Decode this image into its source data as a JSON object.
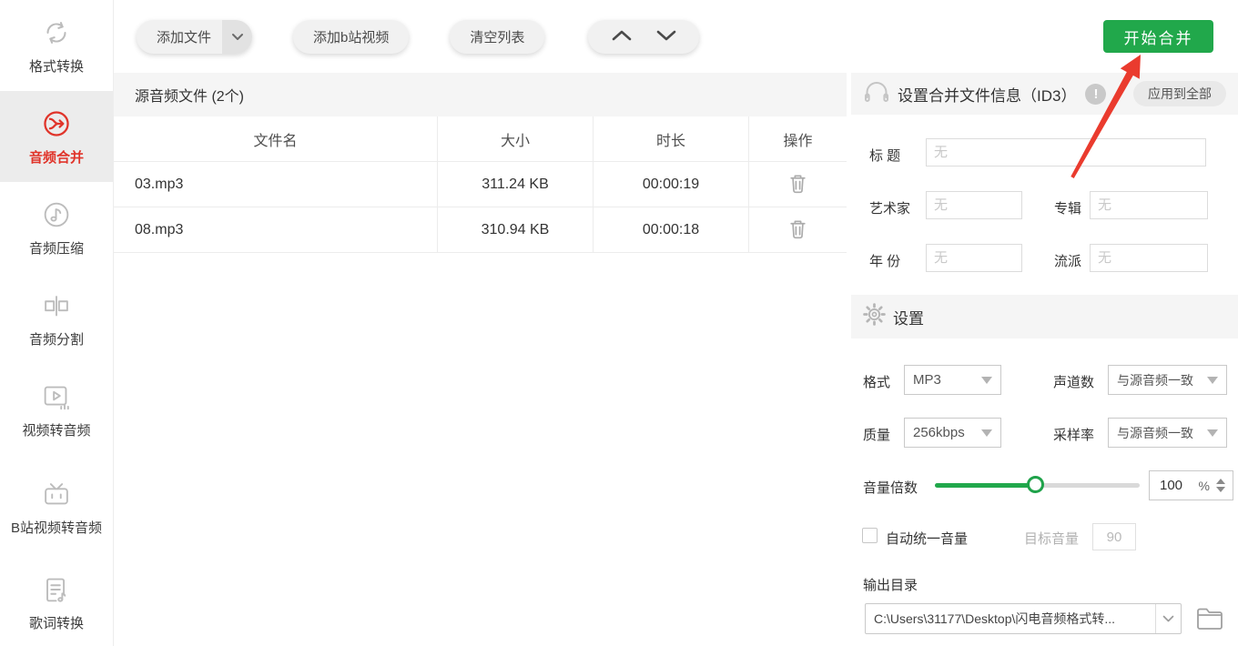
{
  "colors": {
    "accent_red": "#e0342a",
    "accent_green": "#21a84b"
  },
  "sidebar": {
    "items": [
      {
        "label": "格式转换",
        "icon": "format-convert-icon",
        "active": false
      },
      {
        "label": "音频合并",
        "icon": "audio-merge-icon",
        "active": true
      },
      {
        "label": "音频压缩",
        "icon": "audio-compress-icon",
        "active": false
      },
      {
        "label": "音频分割",
        "icon": "audio-split-icon",
        "active": false
      },
      {
        "label": "视频转音频",
        "icon": "video-to-audio-icon",
        "active": false
      },
      {
        "label": "B站视频转音频",
        "icon": "bilibili-video-icon",
        "active": false
      },
      {
        "label": "歌词转换",
        "icon": "lyrics-convert-icon",
        "active": false
      }
    ]
  },
  "toolbar": {
    "add_file": "添加文件",
    "add_bilibili": "添加b站视频",
    "clear_list": "清空列表",
    "start_merge": "开始合并"
  },
  "file_list": {
    "title": "源音频文件 (2个)",
    "columns": [
      "文件名",
      "大小",
      "时长",
      "操作"
    ],
    "rows": [
      {
        "name": "03.mp3",
        "size": "311.24 KB",
        "duration": "00:00:19"
      },
      {
        "name": "08.mp3",
        "size": "310.94 KB",
        "duration": "00:00:18"
      }
    ]
  },
  "id3": {
    "title": "设置合并文件信息（ID3）",
    "warning_glyph": "!",
    "apply_all": "应用到全部",
    "placeholder": "无",
    "labels": {
      "title": "标 题",
      "artist": "艺术家",
      "album": "专辑",
      "year": "年 份",
      "genre": "流派"
    }
  },
  "settings": {
    "title": "设置",
    "format_label": "格式",
    "format_value": "MP3",
    "channels_label": "声道数",
    "channels_value": "与源音频一致",
    "quality_label": "质量",
    "quality_value": "256kbps",
    "samplerate_label": "采样率",
    "samplerate_value": "与源音频一致",
    "volume_label": "音量倍数",
    "volume_value": "100",
    "volume_unit": "%",
    "auto_volume_label": "自动统一音量",
    "target_volume_label": "目标音量",
    "target_volume_value": "90",
    "output_label": "输出目录",
    "output_path": "C:\\Users\\31177\\Desktop\\闪电音频格式转..."
  }
}
